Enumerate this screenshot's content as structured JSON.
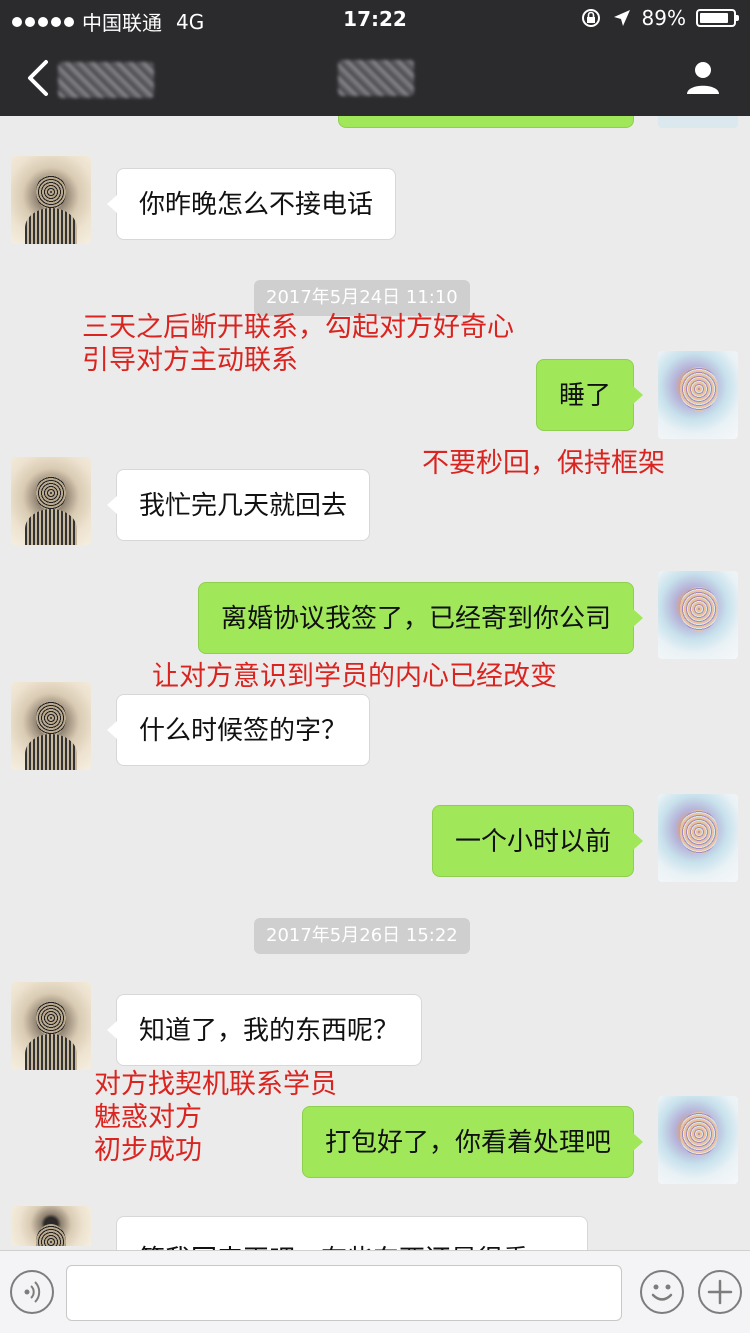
{
  "status_bar": {
    "carrier": "中国联通",
    "network": "4G",
    "time": "17:22",
    "battery": "89%",
    "battery_level": 0.89
  },
  "nav": {
    "back_icon": "chevron-left-icon",
    "profile_icon": "person-icon"
  },
  "timestamps": [
    "2017年5月24日  11:10",
    "2017年5月26日  15:22"
  ],
  "messages": [
    {
      "side": "in",
      "text": "你昨晚怎么不接电话"
    },
    {
      "side": "out",
      "text": "睡了"
    },
    {
      "side": "in",
      "text": "我忙完几天就回去"
    },
    {
      "side": "out",
      "text": "离婚协议我签了，已经寄到你公司"
    },
    {
      "side": "in",
      "text": "什么时候签的字？"
    },
    {
      "side": "out",
      "text": "一个小时以前"
    },
    {
      "side": "in",
      "text": "知道了，我的东西呢？"
    },
    {
      "side": "out",
      "text": "打包好了，你看着处理吧"
    },
    {
      "side": "in",
      "text": "等我回来再吧，有些东西还是很重"
    }
  ],
  "annotations": [
    {
      "lines": [
        "三天之后断开联系，勾起对方好奇心",
        "引导对方主动联系"
      ]
    },
    {
      "lines": [
        "不要秒回，保持框架"
      ]
    },
    {
      "lines": [
        "让对方意识到学员的内心已经改变"
      ]
    },
    {
      "lines": [
        "对方找契机联系学员",
        "魅惑对方",
        "初步成功"
      ]
    }
  ],
  "colors": {
    "header": "#2b2b2e",
    "chat_background": "#ebebeb",
    "outgoing_bubble": "#a0e75a",
    "incoming_bubble": "#ffffff",
    "annotation": "#d92420"
  },
  "input_bar": {
    "voice_icon": "voice-icon",
    "emoji_icon": "emoji-icon",
    "plus_icon": "plus-icon",
    "input_value": ""
  }
}
